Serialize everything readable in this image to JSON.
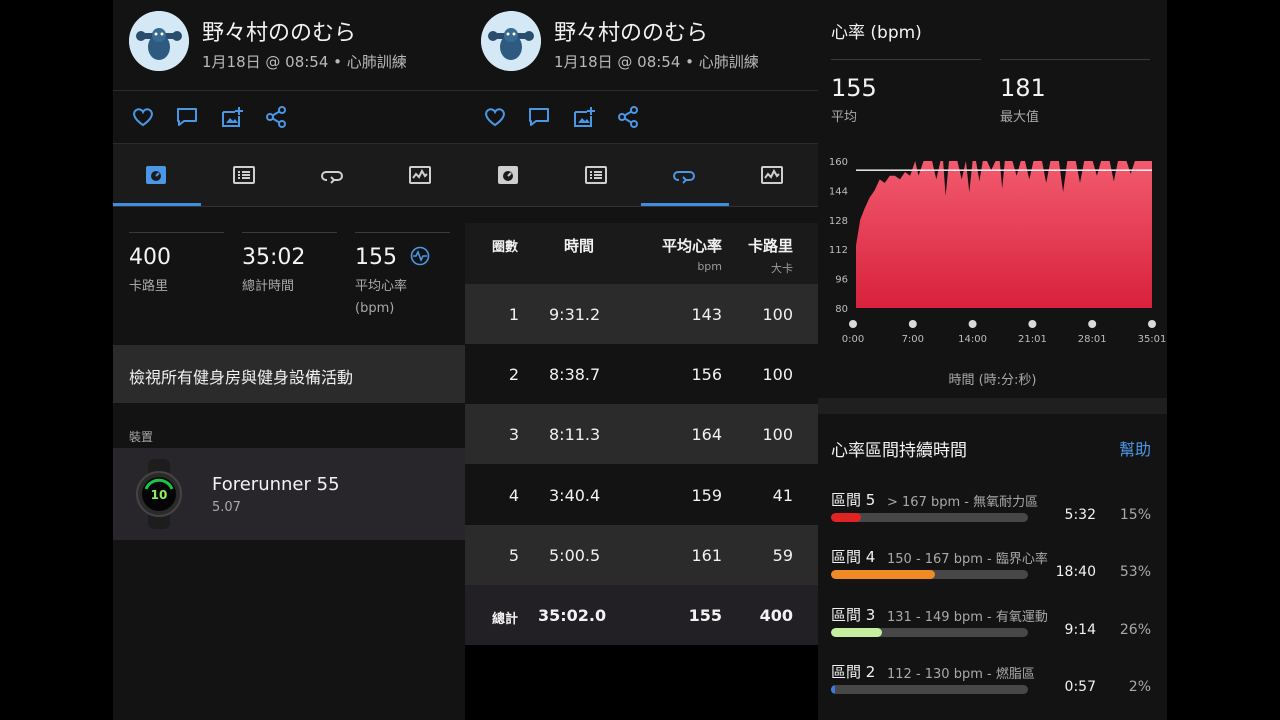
{
  "user": {
    "name": "野々村ののむら",
    "meta": "1月18日 @ 08:54 • 心肺訓練"
  },
  "summary": {
    "stats": [
      {
        "value": "400",
        "label": "卡路里"
      },
      {
        "value": "35:02",
        "label": "總計時間"
      },
      {
        "value": "155",
        "label": "平均心率\n(bpm)"
      }
    ],
    "browse_label": "檢視所有健身房與健身設備活動",
    "device_section": "裝置",
    "device": {
      "name": "Forerunner 55",
      "version": "5.07",
      "face_number": "10"
    }
  },
  "laps": {
    "headers": {
      "lap": "圈數",
      "time": "時間",
      "avg_hr": "平均心率",
      "avg_hr_unit": "bpm",
      "calories": "卡路里",
      "calories_unit": "大卡"
    },
    "rows": [
      {
        "lap": "1",
        "time": "9:31.2",
        "hr": "143",
        "cal": "100"
      },
      {
        "lap": "2",
        "time": "8:38.7",
        "hr": "156",
        "cal": "100"
      },
      {
        "lap": "3",
        "time": "8:11.3",
        "hr": "164",
        "cal": "100"
      },
      {
        "lap": "4",
        "time": "3:40.4",
        "hr": "159",
        "cal": "41"
      },
      {
        "lap": "5",
        "time": "5:00.5",
        "hr": "161",
        "cal": "59"
      }
    ],
    "total": {
      "lap": "總計",
      "time": "35:02.0",
      "hr": "155",
      "cal": "400"
    }
  },
  "heart_rate": {
    "title": "心率 (bpm)",
    "avg": {
      "value": "155",
      "label": "平均"
    },
    "max": {
      "value": "181",
      "label": "最大值"
    },
    "time_axis_label": "時間 (時:分:秒)",
    "zones_title": "心率區間持續時間",
    "help_label": "幫助",
    "zones": [
      {
        "name": "區間 5",
        "desc": "> 167 bpm - 無氧耐力區",
        "time": "5:32",
        "pct": "15%",
        "fraction": 0.15,
        "color": "#e02424"
      },
      {
        "name": "區間 4",
        "desc": "150 - 167 bpm - 臨界心率",
        "time": "18:40",
        "pct": "53%",
        "fraction": 0.53,
        "color": "#f08a24"
      },
      {
        "name": "區間 3",
        "desc": "131 - 149 bpm - 有氧運動",
        "time": "9:14",
        "pct": "26%",
        "fraction": 0.26,
        "color": "#c6f0a0"
      },
      {
        "name": "區間 2",
        "desc": "112 - 130 bpm - 燃脂區",
        "time": "0:57",
        "pct": "2%",
        "fraction": 0.02,
        "color": "#3d7be0"
      }
    ]
  },
  "colors": {
    "accent": "#3e8ddf",
    "chart_fill": "#e8344f"
  },
  "chart_data": {
    "type": "area",
    "title": "心率 (bpm)",
    "xlabel": "時間 (時:分:秒)",
    "ylabel": "",
    "x_ticks": [
      "0:00",
      "7:00",
      "14:00",
      "21:01",
      "28:01",
      "35:01"
    ],
    "y_ticks": [
      80,
      96,
      112,
      128,
      144,
      160
    ],
    "ylim": [
      80,
      160
    ],
    "xlim": [
      0,
      35.02
    ],
    "reference_line": 155,
    "grid": false,
    "series": [
      {
        "x": [
          0,
          0.5,
          1,
          1.6,
          2.2,
          2.8,
          3.4,
          4,
          4.6,
          5.2,
          5.8,
          6.4,
          7,
          7.4,
          7.7,
          8,
          8.5,
          9,
          9.5,
          10,
          10.3,
          10.6,
          11,
          11.5,
          12,
          12.5,
          13,
          13.4,
          13.8,
          14.2,
          14.6,
          15,
          15.5,
          16,
          16.5,
          17,
          17.3,
          17.6,
          18,
          18.5,
          19,
          19.5,
          20,
          20.5,
          21,
          21.5,
          22,
          22.5,
          23,
          23.5,
          24,
          24.5,
          25,
          25.5,
          26,
          26.5,
          27,
          27.5,
          28,
          28.5,
          29,
          29.5,
          30,
          30.5,
          31,
          31.5,
          32,
          32.5,
          33,
          33.5,
          34,
          34.5,
          35.02
        ],
        "y": [
          114,
          128,
          134,
          140,
          144,
          150,
          148,
          152,
          152,
          150,
          154,
          152,
          160,
          152,
          156,
          160,
          160,
          160,
          150,
          160,
          160,
          141,
          160,
          160,
          160,
          150,
          160,
          143,
          160,
          160,
          149,
          160,
          160,
          155,
          160,
          160,
          145,
          160,
          160,
          160,
          152,
          160,
          160,
          150,
          160,
          160,
          160,
          148,
          160,
          160,
          160,
          143,
          160,
          160,
          160,
          148,
          160,
          160,
          160,
          152,
          160,
          160,
          160,
          149,
          160,
          160,
          160,
          153,
          160,
          160,
          160,
          160,
          160
        ]
      }
    ]
  }
}
